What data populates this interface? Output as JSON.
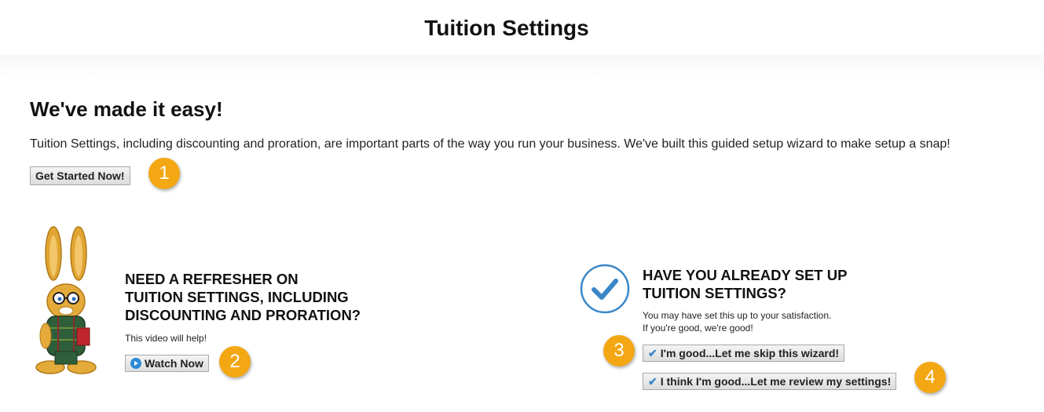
{
  "page": {
    "title": "Tuition Settings"
  },
  "intro": {
    "heading": "We've made it easy!",
    "description": "Tuition Settings, including discounting and proration, are important parts of the way you run your business. We've built this guided setup wizard to make setup a snap!",
    "get_started_label": "Get Started Now!"
  },
  "refresher": {
    "heading_lines": [
      "NEED A REFRESHER ON",
      "TUITION SETTINGS, INCLUDING",
      "DISCOUNTING AND PRORATION?"
    ],
    "subtext": "This video will help!",
    "watch_label": "Watch Now"
  },
  "already_setup": {
    "heading_lines": [
      "HAVE YOU ALREADY SET UP",
      "TUITION SETTINGS?"
    ],
    "subtext_lines": [
      "You may have set this up to your satisfaction.",
      "If you're good, we're good!"
    ],
    "skip_label": "I'm good...Let me skip this wizard!",
    "review_label": "I think I'm good...Let me review my settings!"
  },
  "badges": [
    "1",
    "2",
    "3",
    "4"
  ],
  "colors": {
    "badge": "#f3a712",
    "check_blue": "#3a87c8",
    "play_blue": "#2d8ad6"
  },
  "icons": {
    "mascot": "bunny-mascot-icon",
    "check_circle": "check-circle-icon",
    "play": "play-icon",
    "check": "check-icon"
  }
}
